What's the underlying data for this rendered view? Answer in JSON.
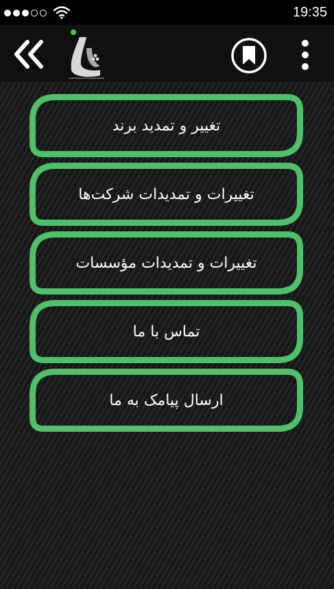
{
  "status_bar": {
    "signal_full_dots": 3,
    "signal_empty_dots": 2,
    "time": "19:35",
    "icons": [
      "signal-dots-icon",
      "wifi-icon"
    ]
  },
  "header": {
    "icons": [
      "double-chevron-left-icon",
      "app-logo",
      "bookmark-icon",
      "more-vertical-icon"
    ]
  },
  "menu": {
    "items": [
      {
        "label": "تغییر و تمدید برند"
      },
      {
        "label": "تغییرات و تمدیدات شرکت‌ها"
      },
      {
        "label": "تغییرات و تمدیدات مؤسسات"
      },
      {
        "label": "تماس با ما"
      },
      {
        "label": "ارسال پیامک به ما"
      }
    ]
  },
  "colors": {
    "accent_green": "#4fc06a",
    "logo_dot_green": "#3ecf4c",
    "header_bg": "#101010",
    "status_bg": "#000000"
  }
}
